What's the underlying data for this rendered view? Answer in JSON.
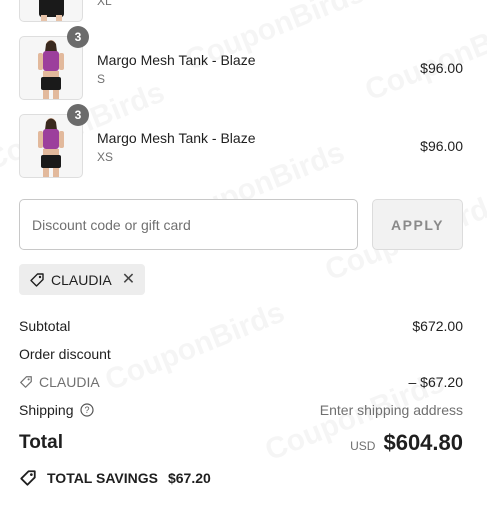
{
  "watermark": {
    "text": "CouponBirds"
  },
  "cart": {
    "partial_item": {
      "variant": "XL"
    },
    "items": [
      {
        "name": "Margo Mesh Tank - Blaze",
        "variant": "S",
        "price": "$96.00",
        "quantity": "3"
      },
      {
        "name": "Margo Mesh Tank - Blaze",
        "variant": "XS",
        "price": "$96.00",
        "quantity": "3"
      }
    ]
  },
  "discount": {
    "placeholder": "Discount code or gift card",
    "apply_label": "APPLY",
    "applied_code": "CLAUDIA"
  },
  "summary": {
    "subtotal_label": "Subtotal",
    "subtotal_value": "$672.00",
    "order_discount_label": "Order discount",
    "discount_code": "CLAUDIA",
    "discount_value": "– $67.20",
    "shipping_label": "Shipping",
    "shipping_value": "Enter shipping address",
    "total_label": "Total",
    "currency": "USD",
    "total_value": "$604.80",
    "savings_label": "TOTAL SAVINGS",
    "savings_value": "$67.20"
  },
  "colors": {
    "product_top": "#9c3f9c",
    "product_shorts": "#1a1a1a",
    "badge": "#6b6b6b",
    "text": "#1f1f1f",
    "muted": "#707070"
  }
}
